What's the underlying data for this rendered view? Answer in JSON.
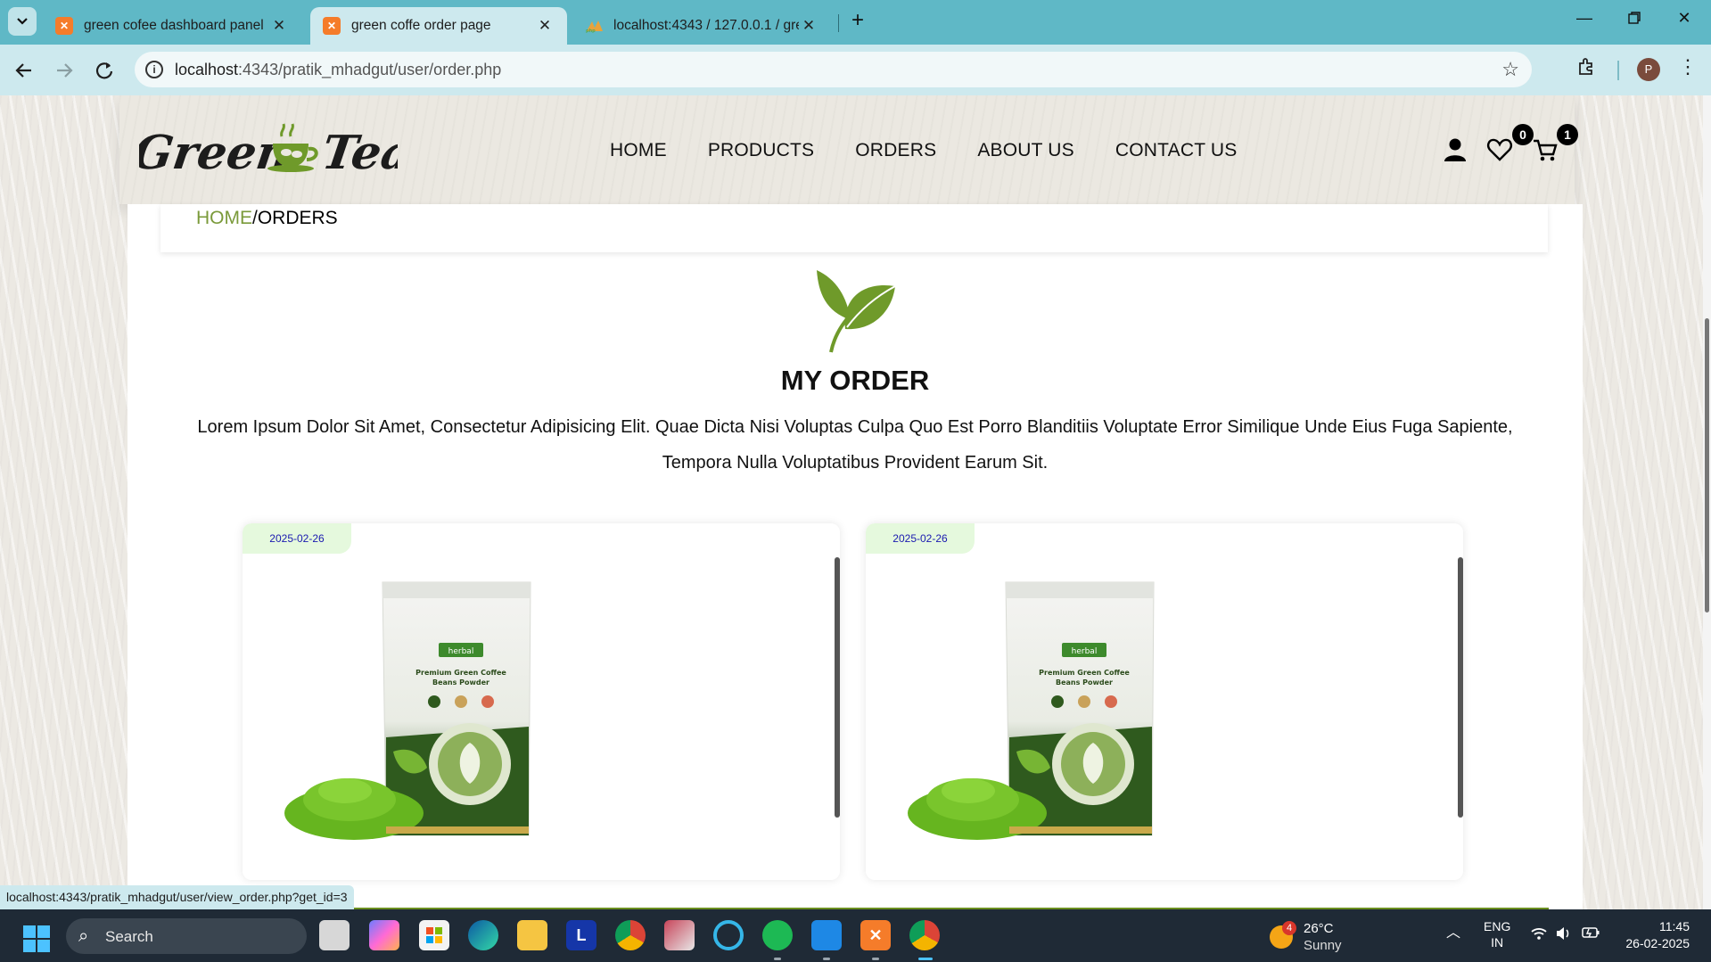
{
  "browser": {
    "tabs": [
      {
        "title": "green cofee dashboard panel",
        "active": false
      },
      {
        "title": "green coffe order page",
        "active": true
      },
      {
        "title": "localhost:4343 / 127.0.0.1 / gree",
        "active": false
      }
    ],
    "url_host": "localhost",
    "url_rest": ":4343/pratik_mhadgut/user/order.php",
    "profile_initial": "P"
  },
  "header": {
    "nav": [
      "HOME",
      "PRODUCTS",
      "ORDERS",
      "ABOUT US",
      "CONTACT US"
    ],
    "wishlist_count": "0",
    "cart_count": "1"
  },
  "breadcrumb": {
    "home": "HOME",
    "separator": "/",
    "current": "ORDERS"
  },
  "main": {
    "title": "MY ORDER",
    "description": "Lorem Ipsum Dolor Sit Amet, Consectetur Adipisicing Elit. Quae Dicta Nisi Voluptas Culpa Quo Est Porro Blanditiis Voluptate Error Similique Unde Eius Fuga Sapiente, Tempora Nulla Voluptatibus Provident Earum Sit."
  },
  "orders": [
    {
      "date": "2025-02-26",
      "product_brand": "herbal",
      "product_name": "Premium Green Coffee Beans Powder"
    },
    {
      "date": "2025-02-26",
      "product_brand": "herbal",
      "product_name": "Premium Green Coffee Beans Powder"
    }
  ],
  "status_url": "localhost:4343/pratik_mhadgut/user/view_order.php?get_id=3",
  "taskbar": {
    "search_label": "Search",
    "weather_badge": "4",
    "temperature": "26°C",
    "condition": "Sunny",
    "language_line1": "ENG",
    "language_line2": "IN",
    "time": "11:45",
    "date": "26-02-2025"
  },
  "colors": {
    "accent_green": "#7a9a3a",
    "tab_bar": "#5fb8c6",
    "date_badge_bg": "#e5f9dd"
  }
}
